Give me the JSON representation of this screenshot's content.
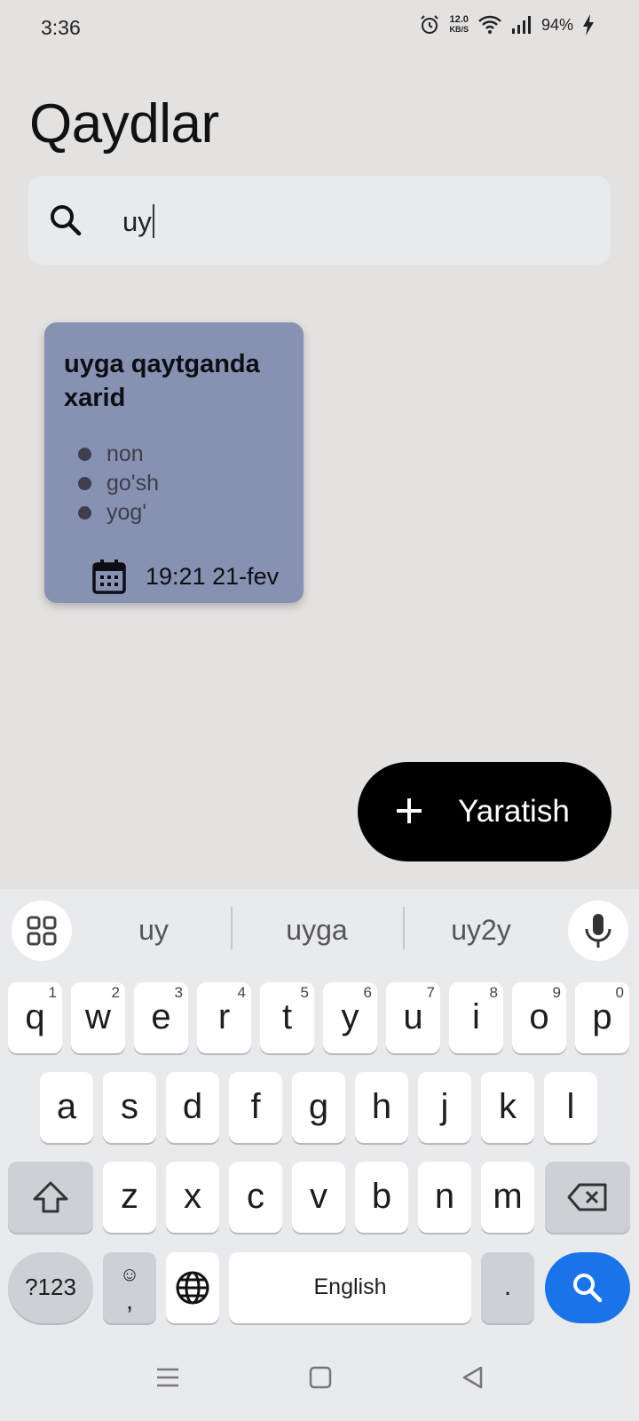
{
  "status_bar": {
    "time": "3:36",
    "net_speed_value": "12.0",
    "net_speed_unit": "KB/S",
    "battery": "94%",
    "icons": [
      "alarm-icon",
      "wifi-icon",
      "signal-icon",
      "charging-icon"
    ]
  },
  "app": {
    "title": "Qaydlar"
  },
  "search": {
    "value": "uy",
    "icon": "search-icon"
  },
  "notes": [
    {
      "title": "uyga qaytganda xarid",
      "items": [
        "non",
        "go'sh",
        "yog'"
      ],
      "date": "19:21 21-fev",
      "color": "#8791b1"
    }
  ],
  "fab": {
    "label": "Yaratish",
    "icon": "plus-icon"
  },
  "keyboard": {
    "suggestions": [
      "uy",
      "uyga",
      "uy2y"
    ],
    "row1": [
      {
        "key": "q",
        "hint": "1"
      },
      {
        "key": "w",
        "hint": "2"
      },
      {
        "key": "e",
        "hint": "3"
      },
      {
        "key": "r",
        "hint": "4"
      },
      {
        "key": "t",
        "hint": "5"
      },
      {
        "key": "y",
        "hint": "6"
      },
      {
        "key": "u",
        "hint": "7"
      },
      {
        "key": "i",
        "hint": "8"
      },
      {
        "key": "o",
        "hint": "9"
      },
      {
        "key": "p",
        "hint": "0"
      }
    ],
    "row2": [
      "a",
      "s",
      "d",
      "f",
      "g",
      "h",
      "j",
      "k",
      "l"
    ],
    "row3": [
      "z",
      "x",
      "c",
      "v",
      "b",
      "n",
      "m"
    ],
    "symbols_key": "?123",
    "emoji_key_top": "☺",
    "emoji_key_bottom": ",",
    "space_label": "English",
    "period_key": ".",
    "accent_color": "#1a73e8"
  }
}
